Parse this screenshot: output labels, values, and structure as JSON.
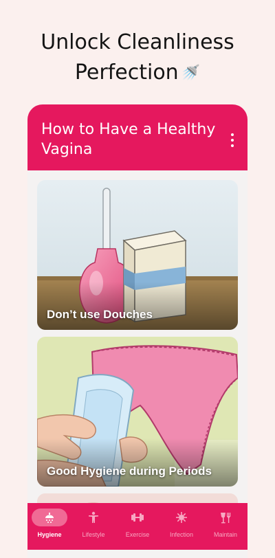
{
  "headline": {
    "line1": "Unlock Cleanliness",
    "line2": "Perfection",
    "emoji": "🚿"
  },
  "app_bar": {
    "title": "How to Have a Healthy Vagina",
    "menu_icon": "more-vert-icon"
  },
  "cards": [
    {
      "label": "Don’t use Douches"
    },
    {
      "label": "Good Hygiene during Periods"
    },
    {
      "label": ""
    }
  ],
  "bottom_nav": {
    "items": [
      {
        "label": "Hygiene",
        "icon": "shower-icon",
        "active": true
      },
      {
        "label": "Lifestyle",
        "icon": "person-stretch-icon",
        "active": false
      },
      {
        "label": "Exercise",
        "icon": "dumbbell-icon",
        "active": false
      },
      {
        "label": "Infection",
        "icon": "virus-icon",
        "active": false
      },
      {
        "label": "Maintain",
        "icon": "dining-icon",
        "active": false
      }
    ]
  },
  "colors": {
    "brand": "#e5185e",
    "background": "#fbf0ee",
    "active_pill": "#f06a95",
    "inactive_nav": "#f7a8c2"
  }
}
